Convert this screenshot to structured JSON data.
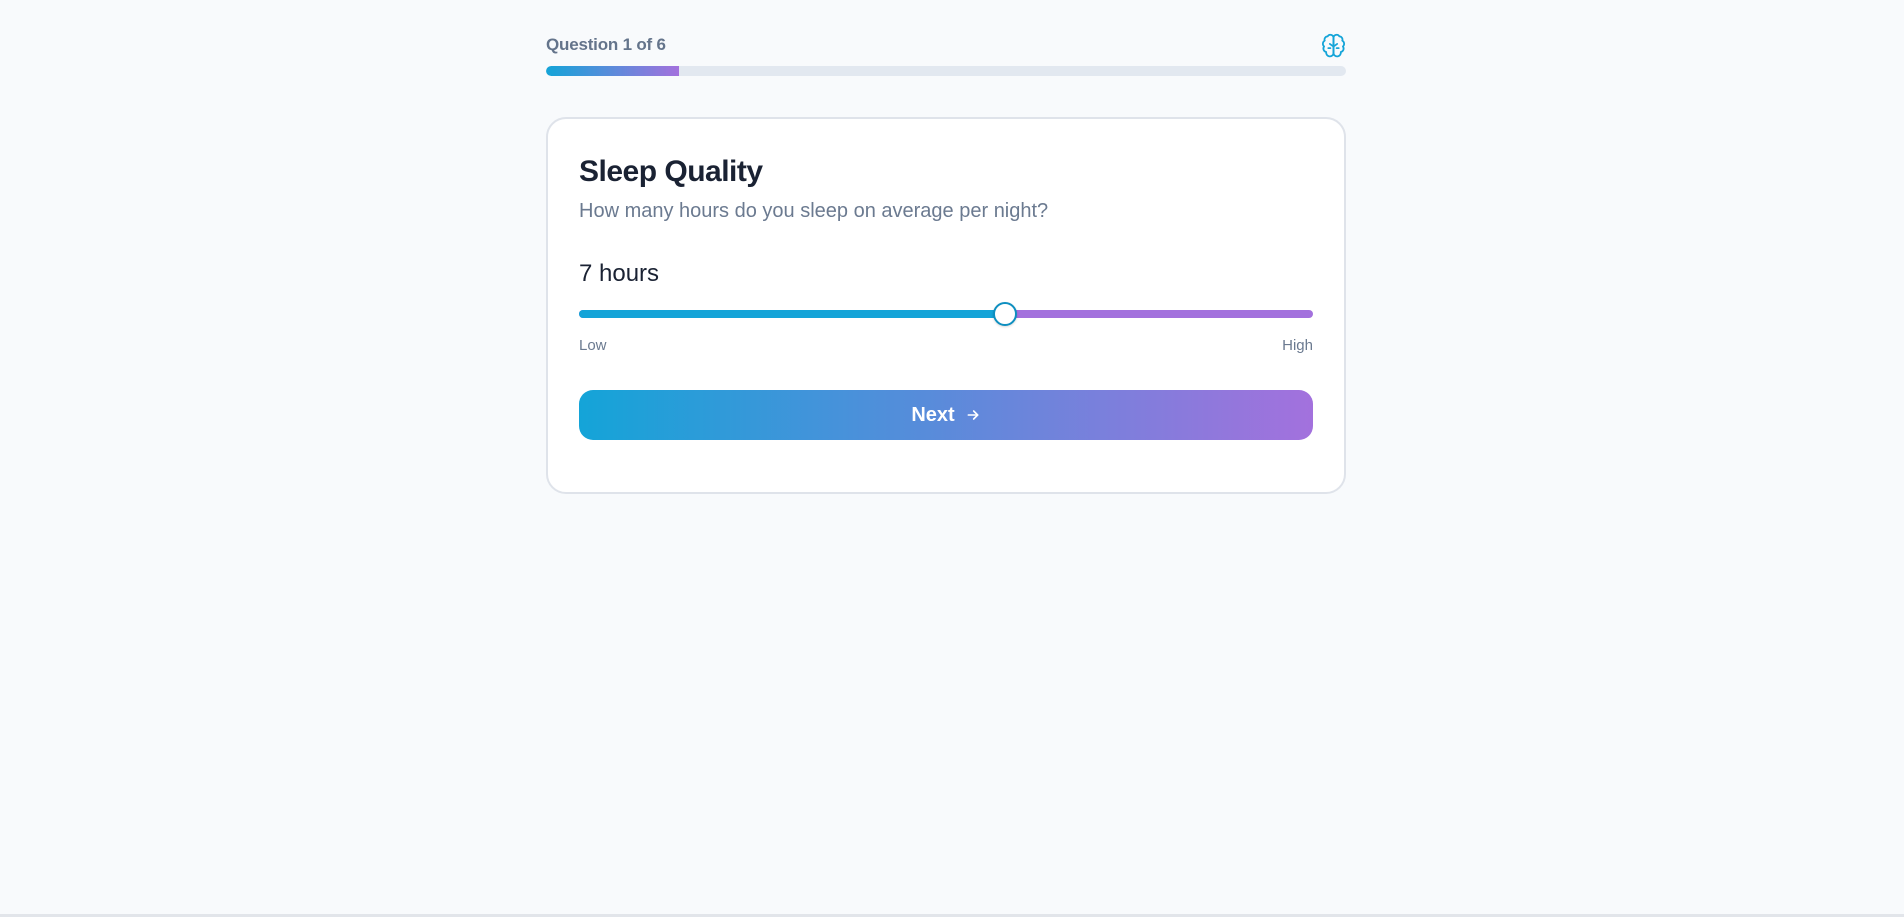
{
  "progress": {
    "label": "Question 1 of 6",
    "current": 1,
    "total": 6,
    "fraction": 0.1667
  },
  "header_icon": "brain-icon",
  "card": {
    "title": "Sleep Quality",
    "question": "How many hours do you sleep on average per night?",
    "slider": {
      "value_label": "7 hours",
      "value": 7,
      "fraction": 0.58,
      "min_label": "Low",
      "max_label": "High"
    },
    "next_button": {
      "label": "Next",
      "icon": "arrow-right-icon"
    }
  },
  "colors": {
    "accent_start": "#14a4d8",
    "accent_end": "#a371dd",
    "background": "#f8fafc"
  }
}
